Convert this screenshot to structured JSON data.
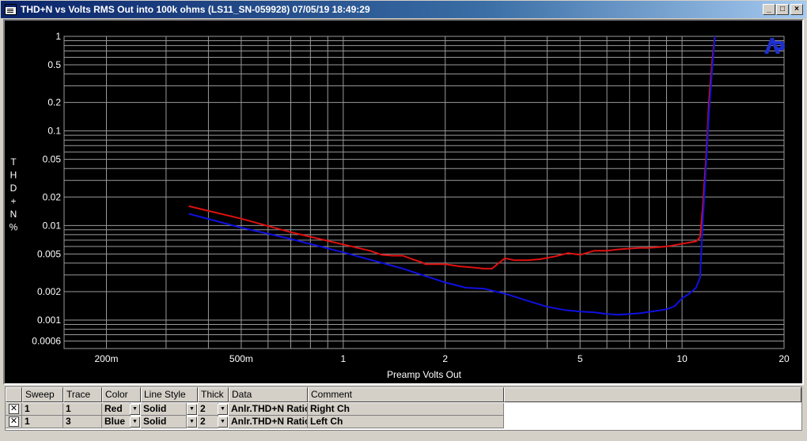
{
  "window": {
    "title": "THD+N vs Volts RMS Out into 100k ohms (LS11_SN-059928)  07/05/19 18:49:29",
    "minimize_label": "_",
    "maximize_label": "□",
    "close_label": "×"
  },
  "chart_data": {
    "type": "line",
    "title": "",
    "xlabel": "Preamp Volts Out",
    "ylabel": "THD+N %",
    "ylabel_chars": [
      "T",
      "H",
      "D",
      "+",
      "N",
      "%"
    ],
    "xscale": "log",
    "yscale": "log",
    "xlim": [
      0.15,
      20
    ],
    "ylim": [
      0.0005,
      1
    ],
    "x_ticks": [
      {
        "v": 0.2,
        "label": "200m"
      },
      {
        "v": 0.5,
        "label": "500m"
      },
      {
        "v": 1,
        "label": "1"
      },
      {
        "v": 2,
        "label": "2"
      },
      {
        "v": 5,
        "label": "5"
      },
      {
        "v": 10,
        "label": "10"
      },
      {
        "v": 20,
        "label": "20"
      }
    ],
    "y_ticks": [
      {
        "v": 1,
        "label": "1"
      },
      {
        "v": 0.5,
        "label": "0.5"
      },
      {
        "v": 0.2,
        "label": "0.2"
      },
      {
        "v": 0.1,
        "label": "0.1"
      },
      {
        "v": 0.05,
        "label": "0.05"
      },
      {
        "v": 0.02,
        "label": "0.02"
      },
      {
        "v": 0.01,
        "label": "0.01"
      },
      {
        "v": 0.005,
        "label": "0.005"
      },
      {
        "v": 0.002,
        "label": "0.002"
      },
      {
        "v": 0.001,
        "label": "0.001"
      },
      {
        "v": 0.0006,
        "label": "0.0006"
      }
    ],
    "grid": true,
    "background": "#000000",
    "grid_color": "#9a9a9a",
    "text_color": "#ffffff",
    "logo": "ap-logo",
    "series": [
      {
        "name": "Right Ch",
        "color": "#e01010",
        "points": [
          [
            0.35,
            0.016
          ],
          [
            0.5,
            0.0118
          ],
          [
            0.7,
            0.0085
          ],
          [
            1.0,
            0.0063
          ],
          [
            1.2,
            0.0054
          ],
          [
            1.3,
            0.0049
          ],
          [
            1.4,
            0.0048
          ],
          [
            1.5,
            0.0048
          ],
          [
            1.6,
            0.0044
          ],
          [
            1.7,
            0.0041
          ],
          [
            1.75,
            0.0039
          ],
          [
            1.9,
            0.0039
          ],
          [
            2.0,
            0.0039
          ],
          [
            2.2,
            0.0037
          ],
          [
            2.4,
            0.0036
          ],
          [
            2.6,
            0.0035
          ],
          [
            2.75,
            0.0035
          ],
          [
            2.85,
            0.0039
          ],
          [
            3.0,
            0.0045
          ],
          [
            3.2,
            0.0043
          ],
          [
            3.5,
            0.0043
          ],
          [
            3.8,
            0.0044
          ],
          [
            4.2,
            0.0047
          ],
          [
            4.6,
            0.0051
          ],
          [
            5.0,
            0.0049
          ],
          [
            5.5,
            0.0054
          ],
          [
            6.0,
            0.0054
          ],
          [
            6.5,
            0.0056
          ],
          [
            7.0,
            0.0057
          ],
          [
            7.5,
            0.0058
          ],
          [
            8.0,
            0.0058
          ],
          [
            8.5,
            0.0059
          ],
          [
            9.0,
            0.006
          ],
          [
            9.5,
            0.0062
          ],
          [
            10.0,
            0.0064
          ],
          [
            10.5,
            0.0066
          ],
          [
            11.0,
            0.0068
          ],
          [
            11.3,
            0.0075
          ],
          [
            11.5,
            0.015
          ],
          [
            11.8,
            0.06
          ],
          [
            12.0,
            0.2
          ],
          [
            12.3,
            0.6
          ],
          [
            12.5,
            1.0
          ]
        ]
      },
      {
        "name": "Left Ch",
        "color": "#1010e0",
        "points": [
          [
            0.35,
            0.0133
          ],
          [
            0.5,
            0.0095
          ],
          [
            0.7,
            0.0072
          ],
          [
            1.0,
            0.0052
          ],
          [
            1.5,
            0.0035
          ],
          [
            2.0,
            0.0025
          ],
          [
            2.3,
            0.0022
          ],
          [
            2.6,
            0.00215
          ],
          [
            3.0,
            0.0019
          ],
          [
            3.5,
            0.0016
          ],
          [
            4.0,
            0.00138
          ],
          [
            4.5,
            0.00128
          ],
          [
            5.0,
            0.00123
          ],
          [
            5.5,
            0.00121
          ],
          [
            6.0,
            0.00116
          ],
          [
            6.5,
            0.00114
          ],
          [
            7.0,
            0.00116
          ],
          [
            7.5,
            0.00118
          ],
          [
            8.0,
            0.00122
          ],
          [
            8.5,
            0.00126
          ],
          [
            9.0,
            0.0013
          ],
          [
            9.5,
            0.0014
          ],
          [
            10.0,
            0.0017
          ],
          [
            10.5,
            0.0019
          ],
          [
            11.0,
            0.0022
          ],
          [
            11.3,
            0.0028
          ],
          [
            11.5,
            0.01
          ],
          [
            11.8,
            0.05
          ],
          [
            12.0,
            0.15
          ],
          [
            12.3,
            0.5
          ],
          [
            12.5,
            1.0
          ]
        ]
      }
    ]
  },
  "legend_table": {
    "headers": [
      "Sweep",
      "Trace",
      "Color",
      "Line Style",
      "Thick",
      "Data",
      "Comment"
    ],
    "rows": [
      {
        "checked": true,
        "sweep": "1",
        "trace": "1",
        "color": "Red",
        "line_style": "Solid",
        "thick": "2",
        "data": "Anlr.THD+N Ratio",
        "comment": "Right Ch"
      },
      {
        "checked": true,
        "sweep": "1",
        "trace": "3",
        "color": "Blue",
        "line_style": "Solid",
        "thick": "2",
        "data": "Anlr.THD+N Ratio",
        "comment": "Left Ch"
      }
    ],
    "check_mark": "✕",
    "dropdown_arrow": "▼"
  }
}
